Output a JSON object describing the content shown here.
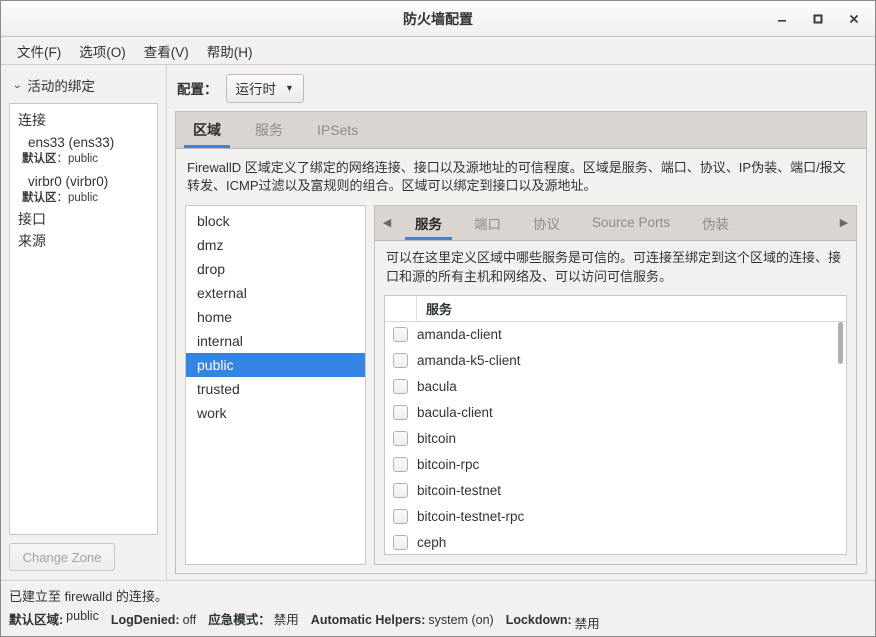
{
  "window": {
    "title": "防火墙配置",
    "controls": {
      "minimize": "–",
      "maximize": "□",
      "close": "✕"
    }
  },
  "menubar": {
    "items": [
      {
        "label": "文件(F)"
      },
      {
        "label": "选项(O)"
      },
      {
        "label": "查看(V)"
      },
      {
        "label": "帮助(H)"
      }
    ]
  },
  "left_pane": {
    "expander_label": "活动的绑定",
    "chevron": "⌄",
    "tree": [
      {
        "type": "root",
        "label": "连接"
      },
      {
        "type": "child",
        "name": "ens33 (ens33)",
        "sub_key": "默认区",
        "sub_sep": "：",
        "sub_value": "public"
      },
      {
        "type": "child",
        "name": "virbr0 (virbr0)",
        "sub_key": "默认区",
        "sub_sep": "：",
        "sub_value": "public"
      },
      {
        "type": "root",
        "label": "接口"
      },
      {
        "type": "root",
        "label": "来源"
      }
    ],
    "change_zone_label": "Change Zone"
  },
  "config": {
    "label": "配置：",
    "selected": "运行时",
    "caret": "▼"
  },
  "main_tabs": [
    {
      "label": "区域",
      "active": true
    },
    {
      "label": "服务",
      "active": false
    },
    {
      "label": "IPSets",
      "active": false
    }
  ],
  "zone_tab": {
    "description": "FirewallD 区域定义了绑定的网络连接、接口以及源地址的可信程度。区域是服务、端口、协议、IP伪装、端口/报文转发、ICMP过滤以及富规则的组合。区域可以绑定到接口以及源地址。",
    "zones": [
      {
        "name": "block",
        "selected": false
      },
      {
        "name": "dmz",
        "selected": false
      },
      {
        "name": "drop",
        "selected": false
      },
      {
        "name": "external",
        "selected": false
      },
      {
        "name": "home",
        "selected": false
      },
      {
        "name": "internal",
        "selected": false
      },
      {
        "name": "public",
        "selected": true
      },
      {
        "name": "trusted",
        "selected": false
      },
      {
        "name": "work",
        "selected": false
      }
    ]
  },
  "inner_tabs": {
    "left_arrow": "◀",
    "right_arrow": "▶",
    "items": [
      {
        "label": "服务",
        "active": true
      },
      {
        "label": "端口",
        "active": false
      },
      {
        "label": "协议",
        "active": false
      },
      {
        "label": "Source Ports",
        "active": false
      },
      {
        "label": "伪装",
        "active": false
      }
    ]
  },
  "services_tab": {
    "description": "可以在这里定义区域中哪些服务是可信的。可连接至绑定到这个区域的连接、接口和源的所有主机和网络及、可以访问可信服务。",
    "column_header": "服务",
    "rows": [
      {
        "name": "amanda-client",
        "checked": false
      },
      {
        "name": "amanda-k5-client",
        "checked": false
      },
      {
        "name": "bacula",
        "checked": false
      },
      {
        "name": "bacula-client",
        "checked": false
      },
      {
        "name": "bitcoin",
        "checked": false
      },
      {
        "name": "bitcoin-rpc",
        "checked": false
      },
      {
        "name": "bitcoin-testnet",
        "checked": false
      },
      {
        "name": "bitcoin-testnet-rpc",
        "checked": false
      },
      {
        "name": "ceph",
        "checked": false
      }
    ]
  },
  "statusbar": {
    "connection": "已建立至 firewalld 的连接。",
    "fields": [
      {
        "key": "默认区域:",
        "value": "public"
      },
      {
        "key": "LogDenied:",
        "value": "off"
      },
      {
        "key": "应急模式：",
        "value": "禁用"
      },
      {
        "key": "Automatic Helpers:",
        "value": "system (on)"
      },
      {
        "key": "Lockdown:",
        "value": "禁用"
      }
    ]
  },
  "colors": {
    "accent": "#3584e4",
    "tabbar": "#d9d6d1",
    "chrome": "#f2f1f0"
  }
}
